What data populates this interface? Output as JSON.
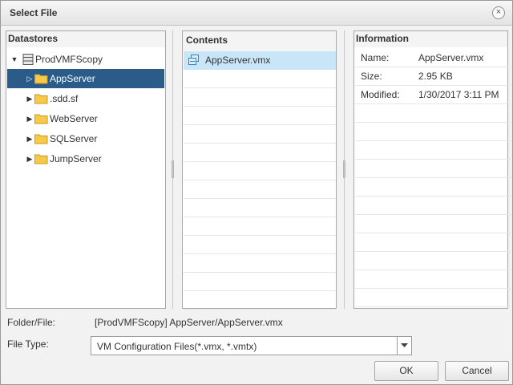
{
  "dialog": {
    "title": "Select File",
    "close_icon": "close-icon"
  },
  "datastores": {
    "header": "Datastores",
    "root": {
      "label": "ProdVMFScopy",
      "icon": "datastore-icon",
      "expanded": true
    },
    "items": [
      {
        "label": "AppServer",
        "icon": "folder-icon",
        "selected": true
      },
      {
        "label": ".sdd.sf",
        "icon": "folder-icon",
        "selected": false
      },
      {
        "label": "WebServer",
        "icon": "folder-icon",
        "selected": false
      },
      {
        "label": "SQLServer",
        "icon": "folder-icon",
        "selected": false
      },
      {
        "label": "JumpServer",
        "icon": "folder-icon",
        "selected": false
      }
    ]
  },
  "contents": {
    "header": "Contents",
    "items": [
      {
        "label": "AppServer.vmx",
        "icon": "vm-file-icon",
        "selected": true
      }
    ]
  },
  "information": {
    "header": "Information",
    "rows": [
      {
        "label": "Name:",
        "value": "AppServer.vmx"
      },
      {
        "label": "Size:",
        "value": "2.95 KB"
      },
      {
        "label": "Modified:",
        "value": "1/30/2017 3:11 PM"
      }
    ]
  },
  "footer": {
    "folder_file_label": "Folder/File:",
    "folder_file_value": "[ProdVMFScopy] AppServer/AppServer.vmx",
    "file_type_label": "File Type:",
    "file_type_value": "VM Configuration Files(*.vmx, *.vmtx)",
    "ok_label": "OK",
    "cancel_label": "Cancel"
  },
  "colors": {
    "tree_selected": "#2b5b88",
    "list_selected": "#c9e5f8",
    "folder": "#f6c94a"
  }
}
